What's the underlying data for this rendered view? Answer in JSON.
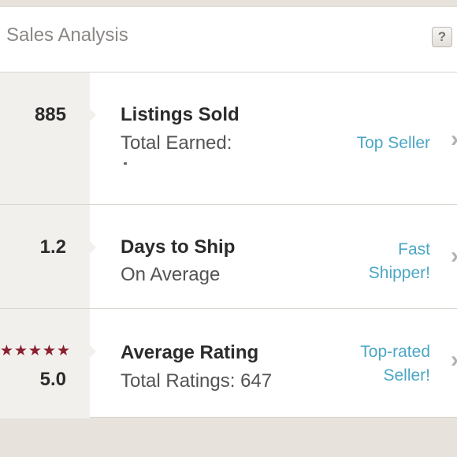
{
  "header": {
    "title": "Sales Analysis",
    "help_label": "?"
  },
  "rows": [
    {
      "value": "885",
      "label": "Listings Sold",
      "sub": "Total Earned:",
      "badge": "Top Seller"
    },
    {
      "value": "1.2",
      "label": "Days to Ship",
      "sub": "On Average",
      "badge_line1": "Fast",
      "badge_line2": "Shipper!"
    },
    {
      "stars": "★★★★★",
      "value": "5.0",
      "label": "Average Rating",
      "sub": "Total Ratings: 647",
      "badge_line1": "Top-rated",
      "badge_line2": "Seller!"
    }
  ],
  "icons": {
    "chevron": "chevron-right-icon",
    "star": "star-icon",
    "help": "help-icon"
  },
  "colors": {
    "accent": "#4ba6c5",
    "star": "#8a1f2e",
    "text": "#2b2b2b"
  }
}
